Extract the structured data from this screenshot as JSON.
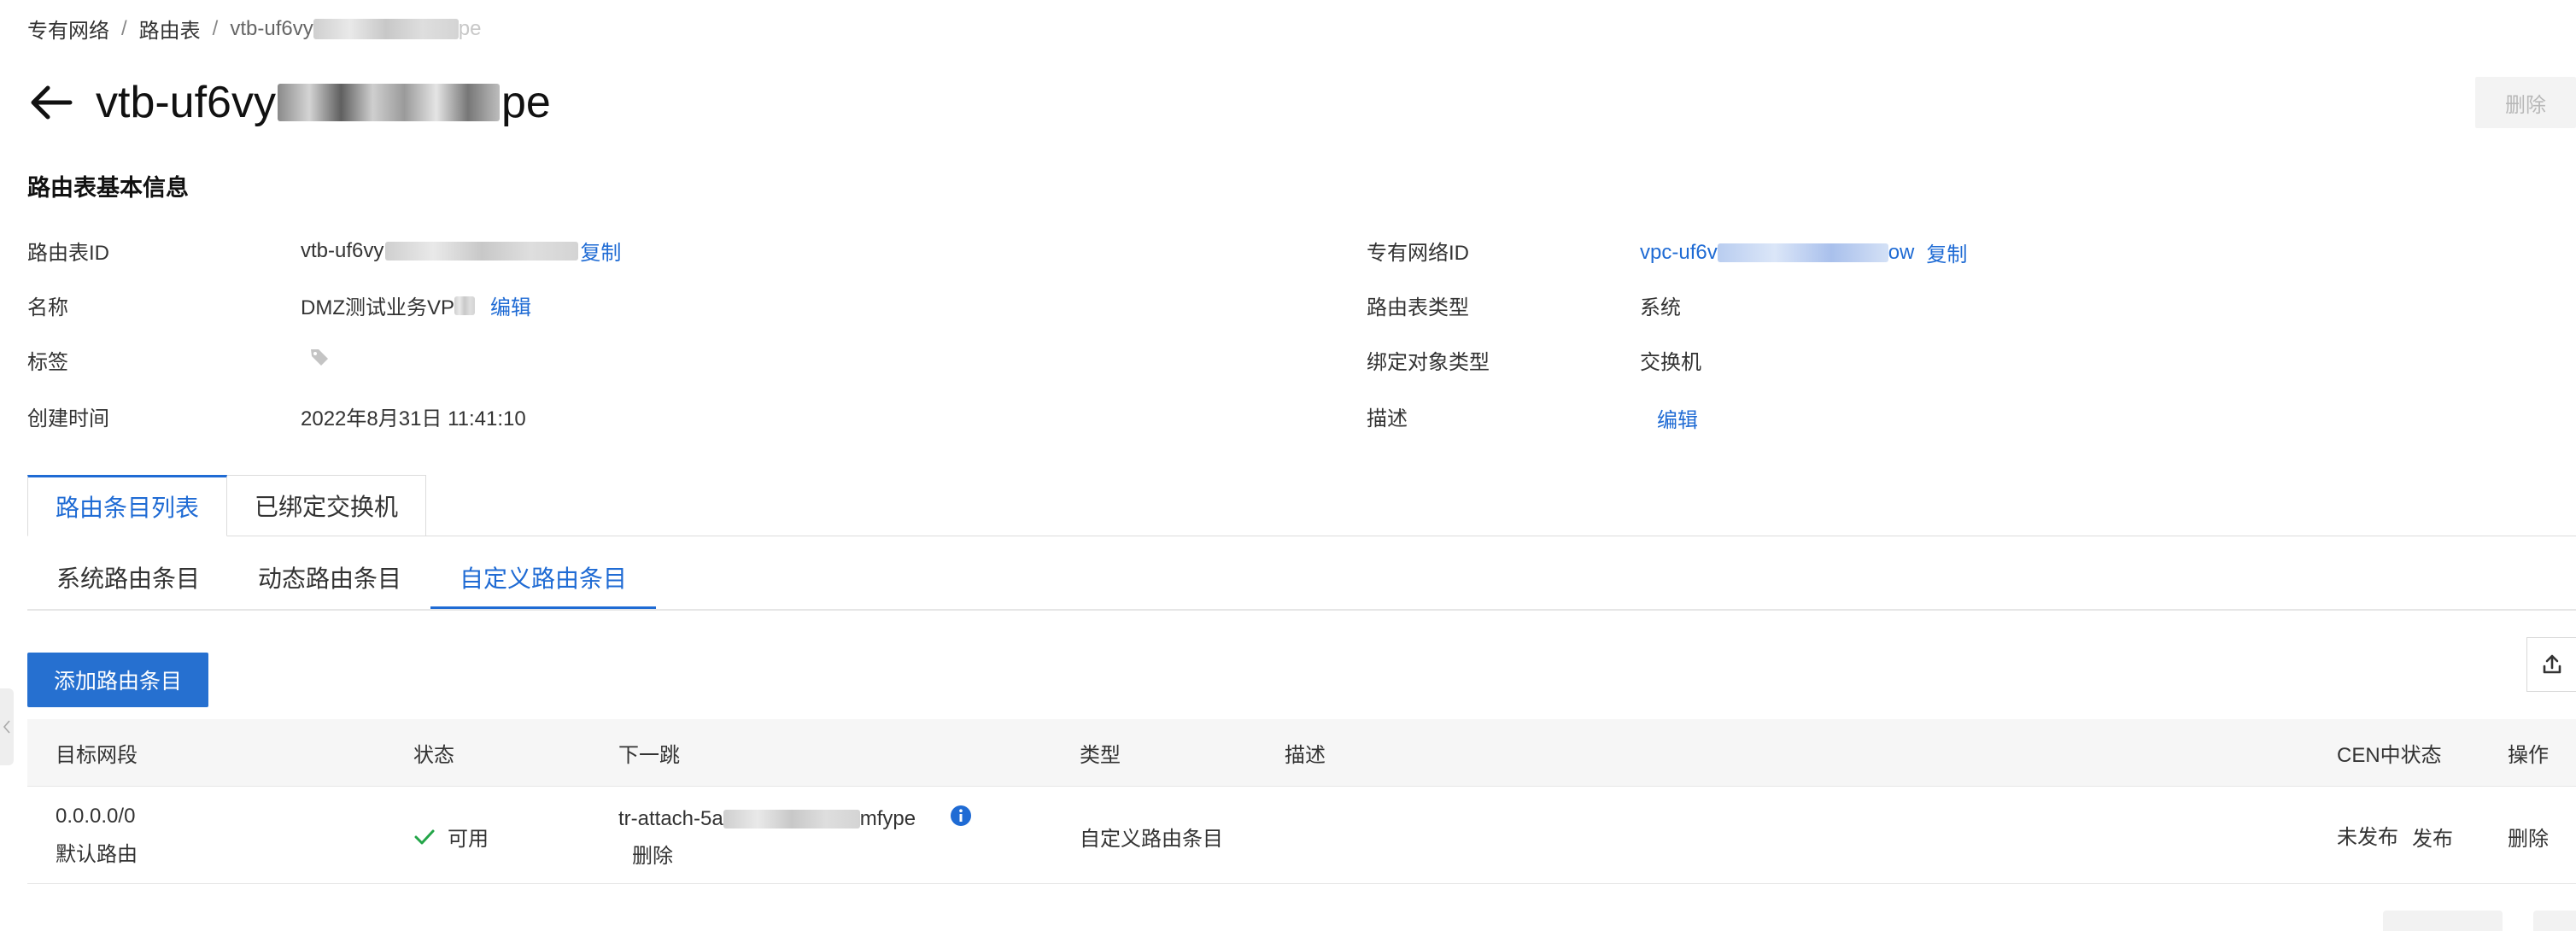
{
  "breadcrumb": {
    "item1": "专有网络",
    "item2": "路由表",
    "current": "vtb-uf6vy",
    "current_tail": "pe",
    "separator": "/"
  },
  "header": {
    "title_prefix": "vtb-uf6vy",
    "title_suffix": "pe",
    "delete_label": "删除"
  },
  "basic_info": {
    "section_title": "路由表基本信息",
    "left": {
      "route_table_id_label": "路由表ID",
      "route_table_id_value": "vtb-uf6vy",
      "copy_label": "复制",
      "name_label": "名称",
      "name_value": "DMZ测试业务VP",
      "edit_label": "编辑",
      "tag_label": "标签",
      "created_label": "创建时间",
      "created_value": "2022年8月31日 11:41:10"
    },
    "right": {
      "vpc_id_label": "专有网络ID",
      "vpc_id_prefix": "vpc-uf6v",
      "vpc_id_suffix": "ow",
      "copy_label": "复制",
      "type_label": "路由表类型",
      "type_value": "系统",
      "bind_type_label": "绑定对象类型",
      "bind_type_value": "交换机",
      "desc_label": "描述",
      "edit_label": "编辑"
    }
  },
  "tabs": [
    {
      "label": "路由条目列表",
      "active": true
    },
    {
      "label": "已绑定交换机",
      "active": false
    }
  ],
  "subtabs": [
    {
      "label": "系统路由条目",
      "active": false
    },
    {
      "label": "动态路由条目",
      "active": false
    },
    {
      "label": "自定义路由条目",
      "active": true
    }
  ],
  "toolbar": {
    "add_label": "添加路由条目"
  },
  "table": {
    "columns": [
      "目标网段",
      "状态",
      "下一跳",
      "类型",
      "描述",
      "CEN中状态",
      "操作"
    ],
    "rows": [
      {
        "cidr": "0.0.0.0/0",
        "cidr_note": "默认路由",
        "status": "可用",
        "next_hop_prefix": "tr-attach-5a",
        "next_hop_suffix": "mfype",
        "next_hop_delete": "删除",
        "type": "自定义路由条目",
        "description": "",
        "cen_status": "未发布",
        "cen_action": "发布",
        "action": "删除"
      }
    ]
  },
  "colors": {
    "accent": "#1f6bd4",
    "primary_button": "#2670d0",
    "success": "#23a548",
    "info_icon": "#1f6bd4"
  }
}
